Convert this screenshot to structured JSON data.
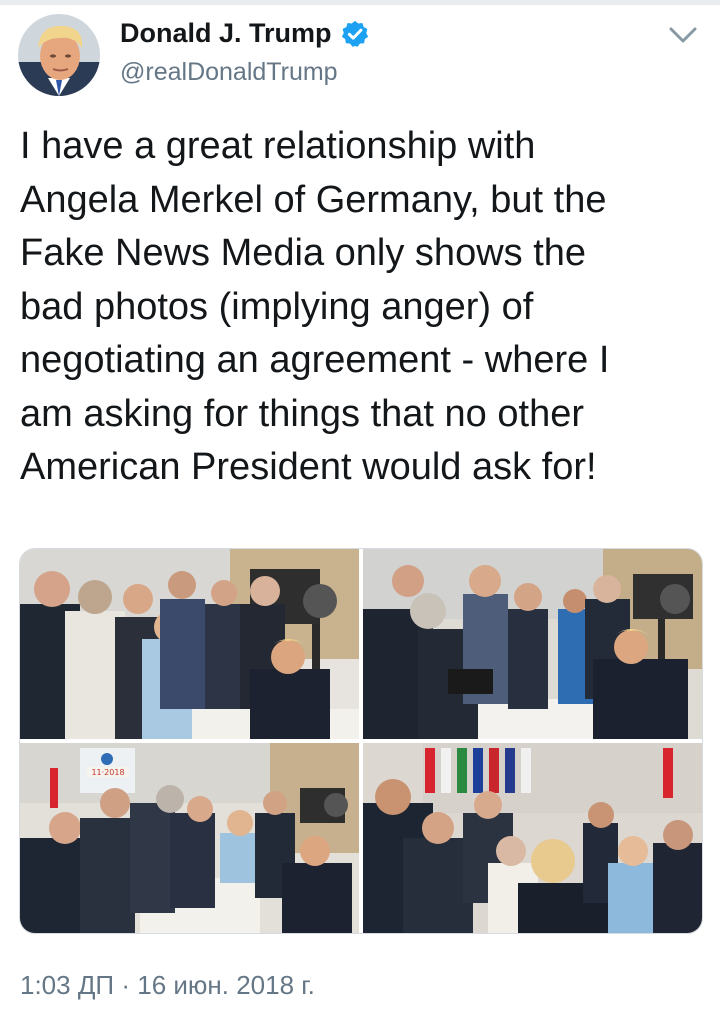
{
  "tweet": {
    "author_name": "Donald J. Trump",
    "handle": "@realDonaldTrump",
    "text": "I have a great relationship with\nAngela Merkel of Germany, but the\nFake News Media only shows the\nbad photos (implying anger) of\nnegotiating an agreement - where I\nam asking for things that no other\nAmerican President would ask for!",
    "timestamp": "1:03 ДП · 16 июн. 2018 г."
  },
  "icons": {
    "verified": "verified-badge-icon",
    "menu": "chevron-down-icon"
  },
  "media": {
    "count": 4,
    "photo_3_sign": "11·2018"
  },
  "colors": {
    "verified": "#1da1f2",
    "text_primary": "#14171a",
    "text_secondary": "#657786",
    "border": "#d5dbe0"
  }
}
